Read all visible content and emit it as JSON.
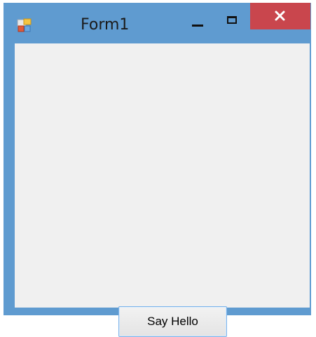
{
  "window": {
    "title": "Form1",
    "icon": "windows-forms-app-icon",
    "frame_color": "#5f9bd0",
    "close_button_color": "#c9464d",
    "client_color": "#f0f0f0"
  },
  "caption_buttons": {
    "minimize_icon": "minimize-icon",
    "maximize_icon": "maximize-icon",
    "close_icon": "close-icon"
  },
  "form": {
    "button_label": "Say Hello"
  }
}
